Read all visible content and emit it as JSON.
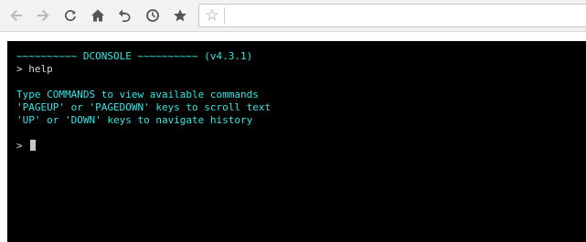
{
  "browser": {
    "url": "",
    "icons": {
      "back": "arrow-left-icon",
      "forward": "arrow-right-icon",
      "reload": "reload-icon",
      "home": "home-icon",
      "undo": "undo-icon",
      "history": "clock-icon",
      "bookmarks": "star-filled-icon",
      "bookmark_page": "star-outline-icon"
    }
  },
  "console": {
    "banner": "~~~~~~~~~~ DCONSOLE ~~~~~~~~~~ (v4.3.1)",
    "command_prompt": "> ",
    "command_text": "help",
    "help_lines": [
      "Type COMMANDS to view available commands",
      "'PAGEUP' or 'PAGEDOWN' keys to scroll text",
      "'UP' or 'DOWN' keys to navigate history"
    ],
    "input_prompt": "> ",
    "input_value": ""
  },
  "colors": {
    "console_background": "#000000",
    "console_text_cyan": "#33e6e6",
    "console_text_white": "#d8d8d8",
    "toolbar_background": "#f2f2f2"
  }
}
